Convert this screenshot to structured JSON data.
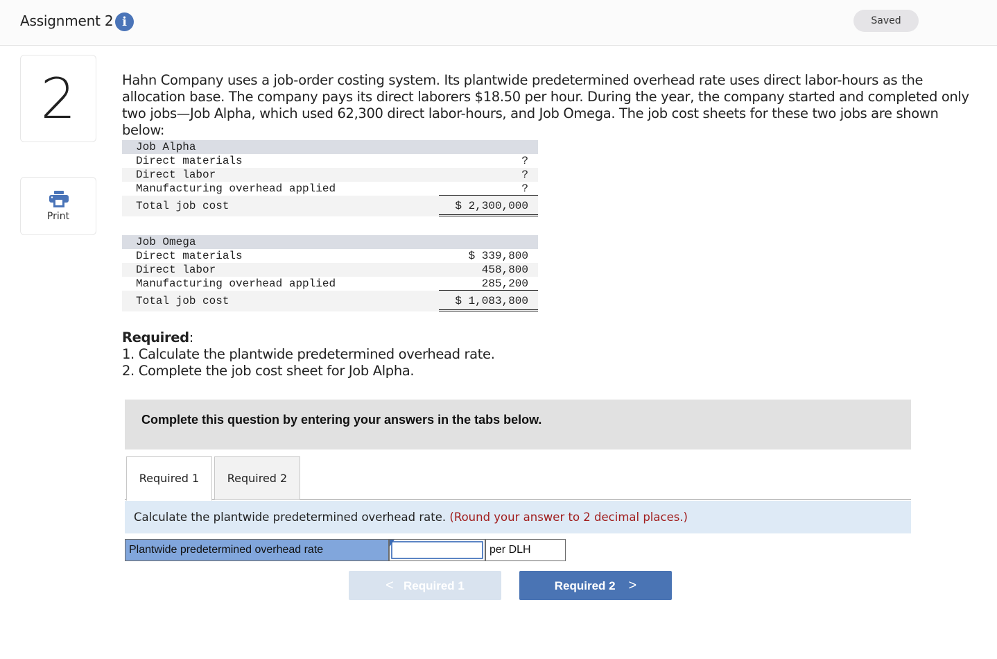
{
  "header": {
    "title": "Assignment 2",
    "info_icon": "info-icon",
    "info_glyph": "i",
    "status": "Saved"
  },
  "sidebar": {
    "question_number": "2",
    "print_label": "Print",
    "print_icon": "printer-icon"
  },
  "question": {
    "intro": "Hahn Company uses a job-order costing system. Its plantwide predetermined overhead rate uses direct labor-hours as the allocation base. The company pays its direct laborers $18.50 per hour. During the year, the company started and completed only two jobs—Job Alpha, which used 62,300 direct labor-hours, and Job Omega. The job cost sheets for these two jobs are shown below:",
    "job_alpha": {
      "title": "Job Alpha",
      "rows": [
        {
          "label": "Direct materials",
          "value": "?"
        },
        {
          "label": "Direct labor",
          "value": "?"
        },
        {
          "label": "Manufacturing overhead applied",
          "value": "?"
        }
      ],
      "total": {
        "label": "Total job cost",
        "value": "$ 2,300,000"
      }
    },
    "job_omega": {
      "title": "Job Omega",
      "rows": [
        {
          "label": "Direct materials",
          "value": "$ 339,800"
        },
        {
          "label": "Direct labor",
          "value": "458,800"
        },
        {
          "label": "Manufacturing overhead applied",
          "value": "285,200"
        }
      ],
      "total": {
        "label": "Total job cost",
        "value": "$ 1,083,800"
      }
    },
    "required_heading": "Required",
    "required_colon": ":",
    "required_items": [
      "1. Calculate the plantwide predetermined overhead rate.",
      "2. Complete the job cost sheet for Job Alpha."
    ]
  },
  "answer_area": {
    "banner": "Complete this question by entering your answers in the tabs below.",
    "tabs": [
      {
        "label": "Required 1",
        "active": true
      },
      {
        "label": "Required 2",
        "active": false
      }
    ],
    "instruction": "Calculate the plantwide predetermined overhead rate.",
    "instruction_hint": "(Round your answer to 2 decimal places.)",
    "field_label": "Plantwide predetermined overhead rate",
    "field_value": "",
    "field_unit": "per DLH",
    "prev_button": {
      "label": "Required 1",
      "chevron": "<",
      "enabled": false
    },
    "next_button": {
      "label": "Required 2",
      "chevron": ">",
      "enabled": true
    }
  }
}
